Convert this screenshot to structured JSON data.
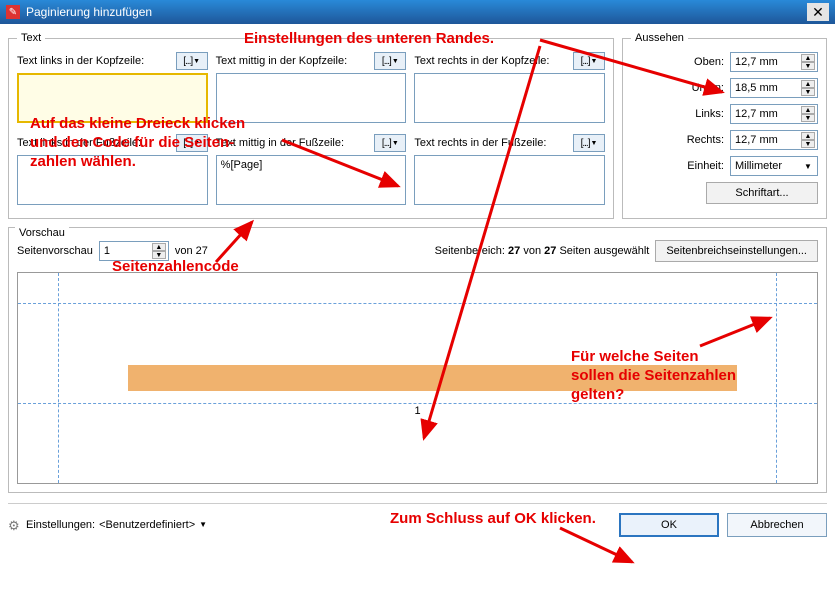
{
  "window": {
    "title": "Paginierung hinzufügen",
    "close": "X"
  },
  "text_section": {
    "legend": "Text",
    "header_left_label": "Text links in der Kopfzeile:",
    "header_center_label": "Text mittig in der Kopfzeile:",
    "header_right_label": "Text rechts in der Kopfzeile:",
    "footer_left_label": "Text links in der Fußzeile:",
    "footer_center_label": "Text mittig in der Fußzeile:",
    "footer_right_label": "Text rechts in der Fußzeile:",
    "macro_btn_glyph": "[...]",
    "header_left_value": "",
    "header_center_value": "",
    "header_right_value": "",
    "footer_left_value": "",
    "footer_center_value": "%[Page]",
    "footer_right_value": ""
  },
  "aussehen": {
    "legend": "Aussehen",
    "oben_label": "Oben:",
    "oben_value": "12,7 mm",
    "unten_label": "Unten:",
    "unten_value": "18,5 mm",
    "links_label": "Links:",
    "links_value": "12,7 mm",
    "rechts_label": "Rechts:",
    "rechts_value": "12,7 mm",
    "einheit_label": "Einheit:",
    "einheit_value": "Millimeter",
    "schriftart_btn": "Schriftart..."
  },
  "vorschau": {
    "legend": "Vorschau",
    "seitenvorschau_label": "Seitenvorschau",
    "seitenvorschau_value": "1",
    "von_label": "von 27",
    "range_prefix": "Seitenbereich: ",
    "range_bold1": "27",
    "range_mid": " von ",
    "range_bold2": "27",
    "range_suffix": " Seiten ausgewählt",
    "range_btn": "Seitenbreichseinstellungen...",
    "page_number": "1"
  },
  "bottom": {
    "settings_label": "Einstellungen:",
    "settings_value": "<Benutzerdefiniert>",
    "ok": "OK",
    "cancel": "Abbrechen"
  },
  "annotations": {
    "a1": "Einstellungen des unteren Randes.",
    "a2_l1": "Auf das kleine Dreieck klicken",
    "a2_l2": "und den Code für die Seiten-",
    "a2_l3": "zahlen wählen.",
    "a3": "Seitenzahlencode",
    "a4_l1": "Für welche Seiten",
    "a4_l2": "sollen die Seitenzahlen",
    "a4_l3": "gelten?",
    "a5": "Zum Schluss auf OK klicken."
  }
}
